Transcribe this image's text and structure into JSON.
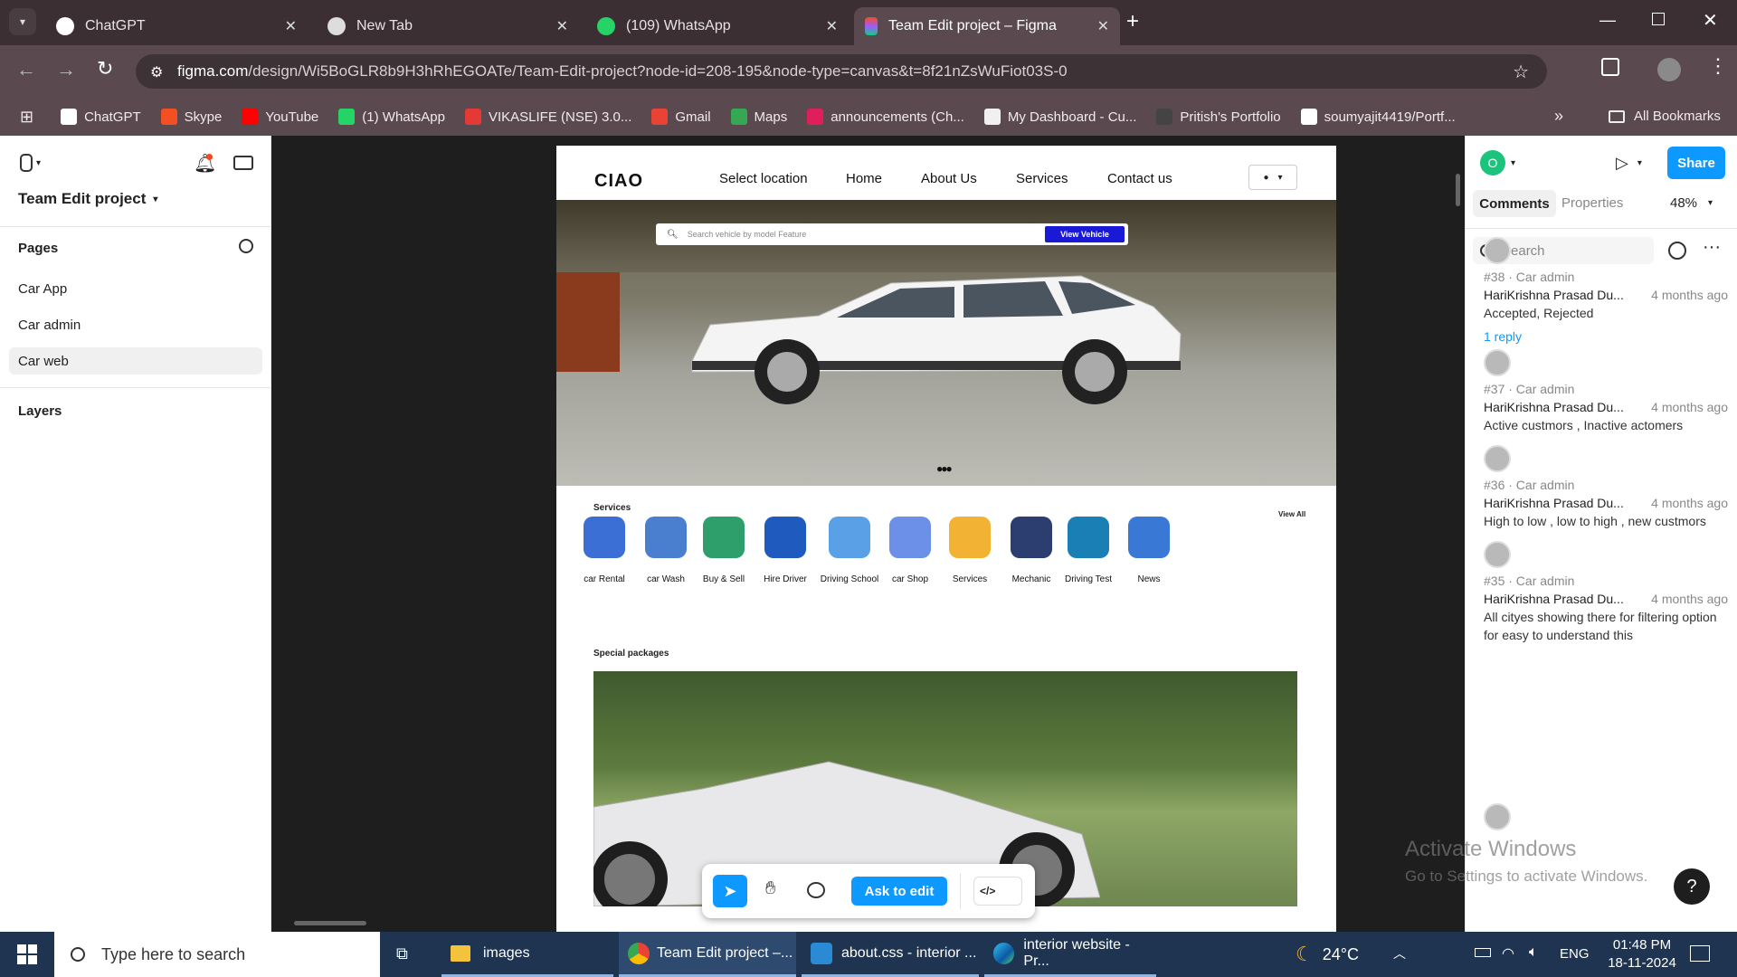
{
  "browser": {
    "tabs": [
      {
        "title": "ChatGPT",
        "active": false
      },
      {
        "title": "New Tab",
        "active": false
      },
      {
        "title": "(109) WhatsApp",
        "active": false
      },
      {
        "title": "Team Edit project – Figma",
        "active": true
      }
    ],
    "url_domain": "figma.com",
    "url_path": "/design/Wi5BoGLR8b9H3hRhEGOATe/Team-Edit-project?node-id=208-195&node-type=canvas&t=8f21nZsWuFiot03S-0",
    "bookmarks": [
      {
        "label": "ChatGPT",
        "color": "#ffffff"
      },
      {
        "label": "Skype",
        "color": "#f25022"
      },
      {
        "label": "YouTube",
        "color": "#ff0000"
      },
      {
        "label": "(1) WhatsApp",
        "color": "#25d366"
      },
      {
        "label": "VIKASLIFE (NSE) 3.0...",
        "color": "#e53935"
      },
      {
        "label": "Gmail",
        "color": "#ea4335"
      },
      {
        "label": "Maps",
        "color": "#34a853"
      },
      {
        "label": "announcements (Ch...",
        "color": "#e01e5a"
      },
      {
        "label": "My Dashboard - Cu...",
        "color": "#f0f0f0"
      },
      {
        "label": "Pritish's Portfolio",
        "color": "#444444"
      },
      {
        "label": "soumyajit4419/Portf...",
        "color": "#ffffff"
      }
    ],
    "all_bookmarks": "All Bookmarks"
  },
  "figma": {
    "project_title": "Team Edit project",
    "pages_label": "Pages",
    "pages": [
      "Car App",
      "Car admin",
      "Car web"
    ],
    "selected_page": "Car web",
    "layers_label": "Layers",
    "avatar_initial": "O",
    "share_label": "Share",
    "panel_tabs": [
      "Comments",
      "Properties"
    ],
    "zoom": "48%",
    "search_placeholder": "Search",
    "toolbar": {
      "ask_to_edit": "Ask to edit"
    }
  },
  "design": {
    "brand": "CIAO",
    "nav": [
      "Select location",
      "Home",
      "About Us",
      "Services",
      "Contact us"
    ],
    "search_placeholder": "Search vehicle by model Feature",
    "search_button": "View Vehicle",
    "services_title": "Services",
    "view_all": "View All",
    "services": [
      {
        "label": "car Rental",
        "icon": "car-rental-icon",
        "color": "#3b6fd6"
      },
      {
        "label": "car Wash",
        "icon": "car-wash-icon",
        "color": "#4a7fd0"
      },
      {
        "label": "Buy & Sell",
        "icon": "handshake-icon",
        "color": "#2e9e6a"
      },
      {
        "label": "Hire Driver",
        "icon": "hiring-icon",
        "color": "#1f5bbf"
      },
      {
        "label": "Driving School",
        "icon": "steering-wheel-icon",
        "color": "#5aa0e6"
      },
      {
        "label": "car Shop",
        "icon": "shopping-bag-icon",
        "color": "#6c8fe8"
      },
      {
        "label": "Services",
        "icon": "service-hand-icon",
        "color": "#f2b233"
      },
      {
        "label": "Mechanic",
        "icon": "wrench-icon",
        "color": "#2c3e70"
      },
      {
        "label": "Driving Test",
        "icon": "checkmark-icon",
        "color": "#1a7fb5"
      },
      {
        "label": "News",
        "icon": "news-icon",
        "color": "#3a78d6"
      }
    ],
    "special_packages_title": "Special packages"
  },
  "comments": [
    {
      "id": "#38 · Car admin",
      "author": "HariKrishna Prasad Du...",
      "time": "4 months ago",
      "text": "Accepted, Rejected",
      "reply": "1 reply"
    },
    {
      "id": "#37 · Car admin",
      "author": "HariKrishna Prasad Du...",
      "time": "4 months ago",
      "text": "Active custmors , Inactive actomers"
    },
    {
      "id": "#36 · Car admin",
      "author": "HariKrishna Prasad Du...",
      "time": "4 months ago",
      "text": "High to low , low to high , new custmors"
    },
    {
      "id": "#35 · Car admin",
      "author": "HariKrishna Prasad Du...",
      "time": "4 months ago",
      "text": "All cityes showing there for filtering option for easy to understand this"
    }
  ],
  "watermark": {
    "title": "Activate Windows",
    "subtitle": "Go to Settings to activate Windows."
  },
  "taskbar": {
    "search_placeholder": "Type here to search",
    "apps": [
      "images",
      "Team Edit project –...",
      "about.css - interior ...",
      "interior website - Pr..."
    ],
    "weather": "24°C",
    "lang": "ENG",
    "time": "01:48 PM",
    "date": "18-11-2024"
  }
}
